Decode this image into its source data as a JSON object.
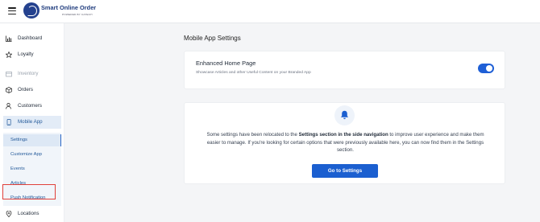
{
  "header": {
    "brand_name": "Smart Online Order",
    "brand_sub": "POWERED BY CATECH"
  },
  "sidebar": {
    "items": [
      {
        "label": "Dashboard",
        "icon": "bar-chart-icon"
      },
      {
        "label": "Loyalty",
        "icon": "star-icon"
      },
      {
        "label": "Inventory",
        "icon": "box-icon",
        "disabled": true
      },
      {
        "label": "Orders",
        "icon": "package-icon"
      },
      {
        "label": "Customers",
        "icon": "user-icon"
      },
      {
        "label": "Mobile App",
        "icon": "phone-icon",
        "active": true
      },
      {
        "label": "Locations",
        "icon": "location-pin-icon"
      }
    ],
    "sub_items": [
      {
        "label": "Settings",
        "active": true
      },
      {
        "label": "Customize App"
      },
      {
        "label": "Events",
        "highlighted": true
      },
      {
        "label": "Articles"
      },
      {
        "label": "Push Notification"
      }
    ]
  },
  "main": {
    "page_title": "Mobile App Settings",
    "enhanced": {
      "title": "Enhanced Home Page",
      "description": "Showcase Articles and other Useful Content on your Branded App",
      "toggle_on": true
    },
    "notice": {
      "part1": "Some settings have been relocated to the ",
      "bold": "Settings section in the side navigation",
      "part2": " to improve user experience and make them easier to manage. If you're looking for certain options that were previously available here, you can now find them in the Settings section.",
      "button_label": "Go to Settings"
    }
  },
  "colors": {
    "accent": "#1b5fd0",
    "highlight_outline": "#e0403a",
    "active_nav_bg": "#e3ecf7"
  }
}
